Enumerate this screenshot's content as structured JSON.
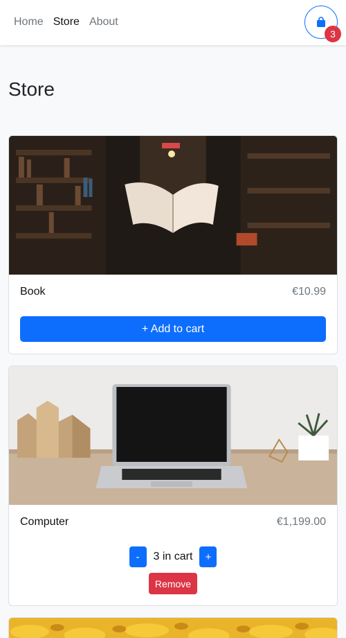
{
  "nav": {
    "links": [
      {
        "label": "Home",
        "active": false
      },
      {
        "label": "Store",
        "active": true
      },
      {
        "label": "About",
        "active": false
      }
    ],
    "cart_icon": "shopping-bag-icon",
    "cart_count": "3"
  },
  "page": {
    "title": "Store"
  },
  "products": [
    {
      "name": "Book",
      "price": "€10.99",
      "image": "flying-book-in-library-photo",
      "add_label": "+ Add to cart"
    },
    {
      "name": "Computer",
      "price": "€1,199.00",
      "image": "laptop-on-desk-photo",
      "decrement_label": "-",
      "quantity_label": "3 in cart",
      "increment_label": "+",
      "remove_label": "Remove"
    },
    {
      "image": "bananas-photo"
    }
  ],
  "colors": {
    "primary": "#0d6efd",
    "danger": "#dc3545",
    "muted": "#6c757d",
    "background": "#f8f9fa"
  }
}
